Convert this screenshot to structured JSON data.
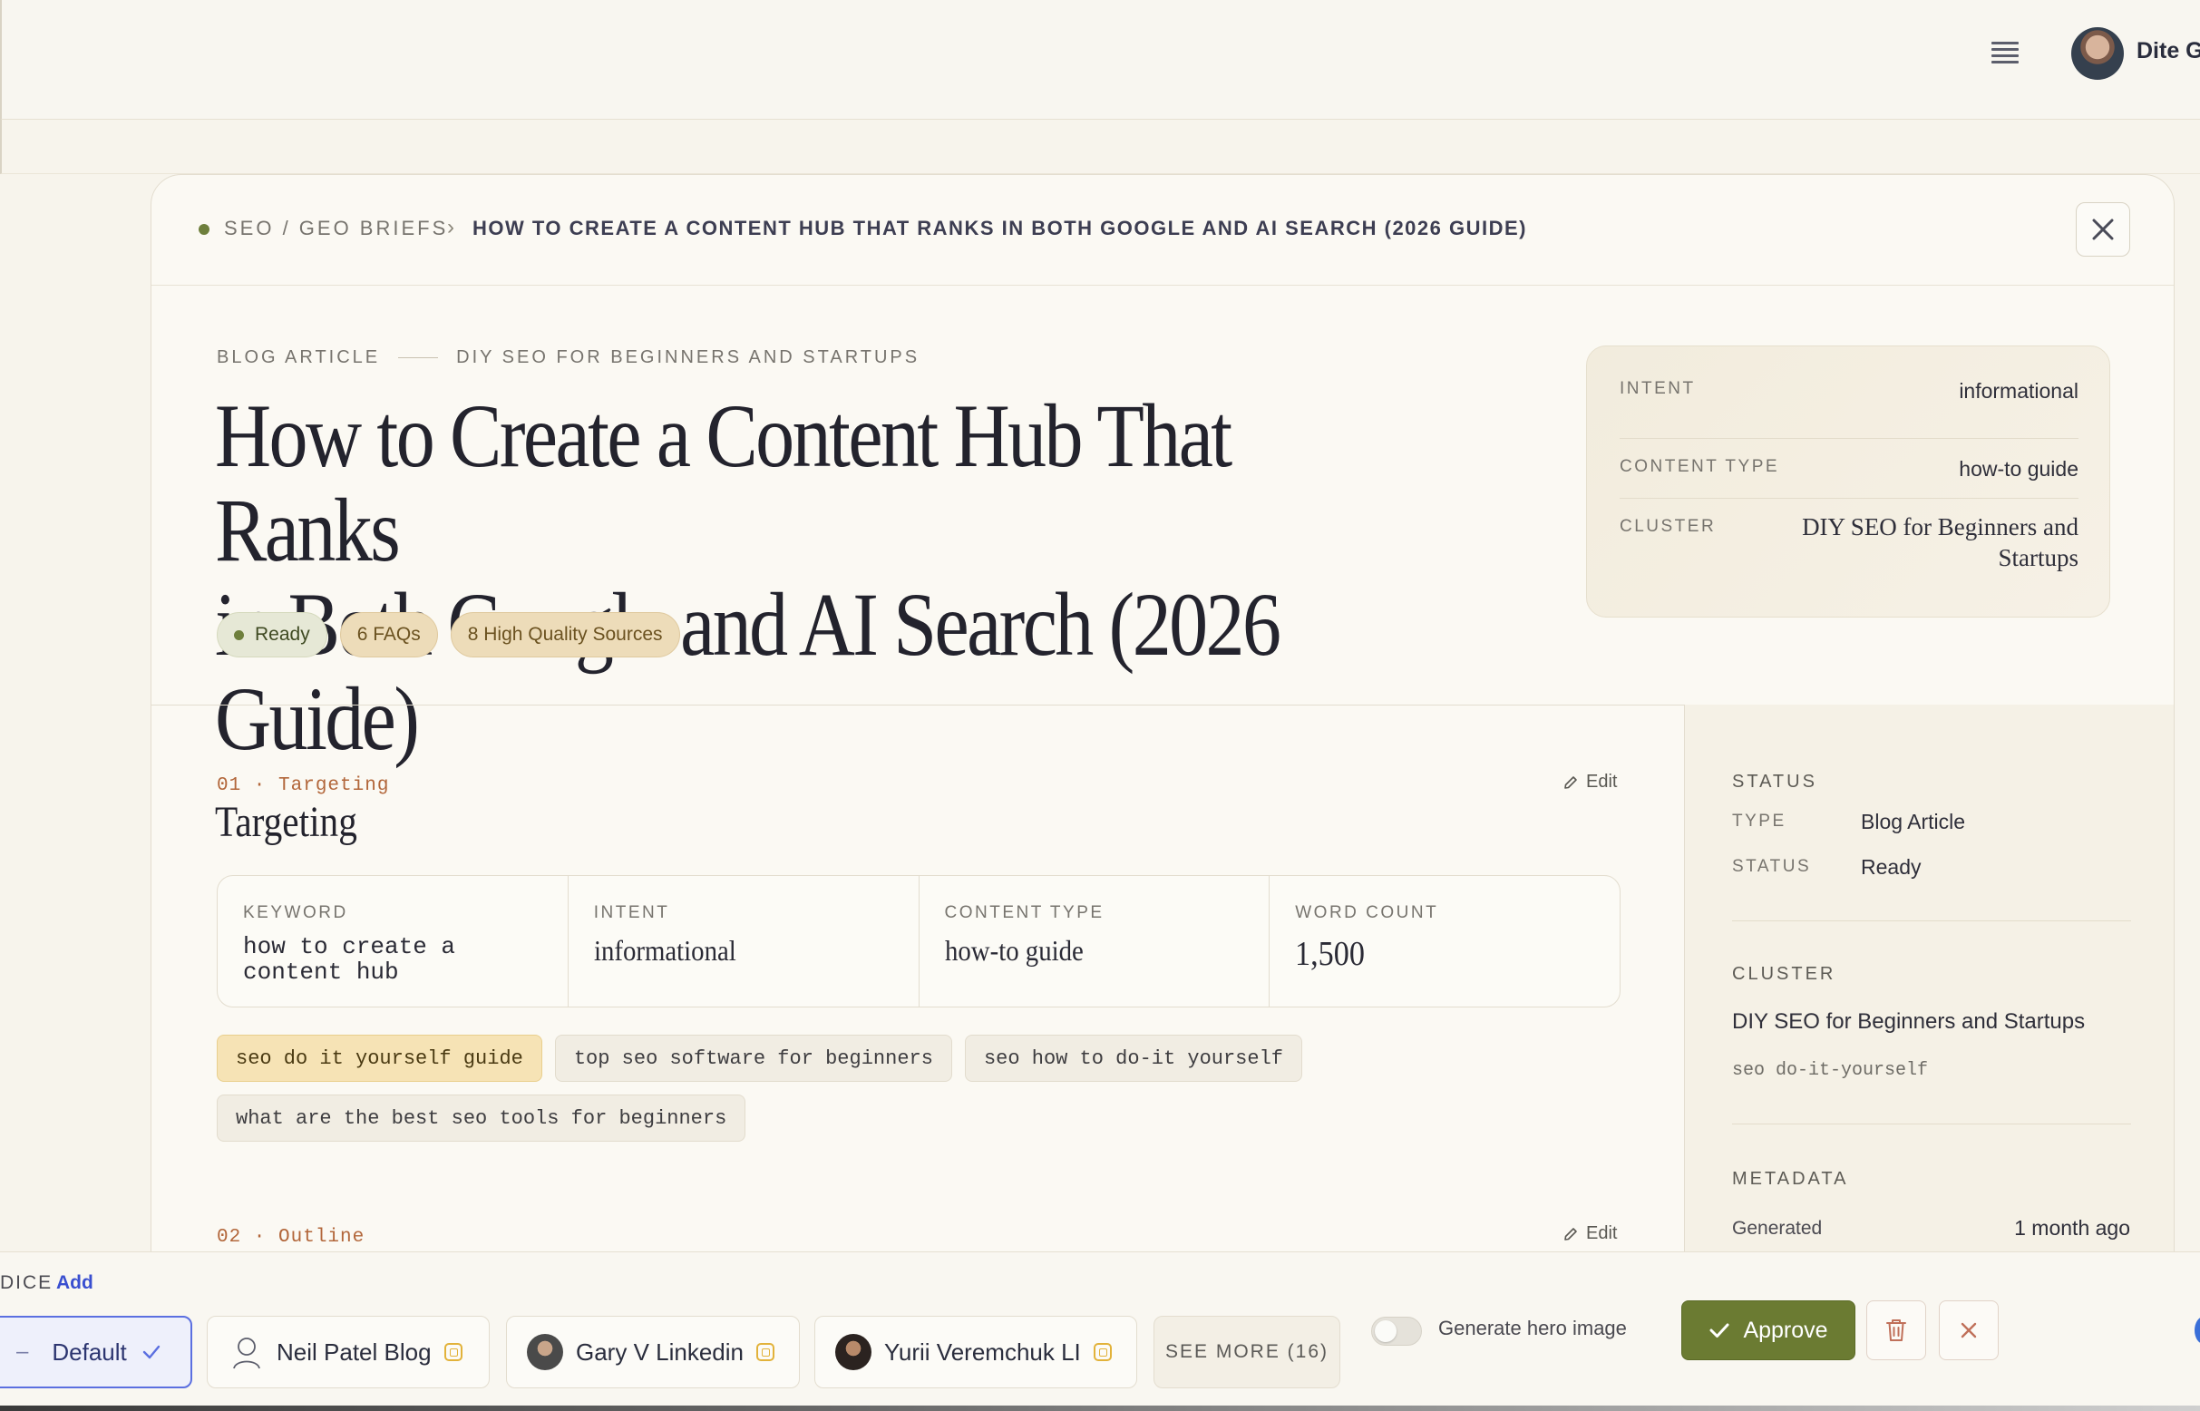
{
  "user": {
    "name": "Dite Ga"
  },
  "breadcrumb": {
    "root": "SEO / GEO BRIEFS",
    "separator": "›",
    "current": "HOW TO CREATE A CONTENT HUB THAT RANKS IN BOTH GOOGLE AND AI SEARCH (2026 GUIDE)"
  },
  "hero": {
    "type_label": "BLOG ARTICLE",
    "cluster_label": "DIY SEO FOR BEGINNERS AND STARTUPS",
    "title_line1": "How to Create a Content Hub That Ranks",
    "title_line2": "in Both Google and AI Search (2026 Guide)",
    "pills": {
      "ready": "Ready",
      "faqs": "6 FAQs",
      "sources": "8 High Quality Sources"
    }
  },
  "info_card": {
    "intent_key": "INTENT",
    "intent_value": "informational",
    "content_type_key": "CONTENT TYPE",
    "content_type_value": "how-to guide",
    "cluster_key": "CLUSTER",
    "cluster_value_line1": "DIY SEO for Beginners and",
    "cluster_value_line2": "Startups"
  },
  "targeting": {
    "number": "01 · Targeting",
    "title": "Targeting",
    "edit": "Edit",
    "metrics": {
      "keyword_key": "KEYWORD",
      "keyword_line1": "how to create a",
      "keyword_line2": "content hub",
      "intent_key": "INTENT",
      "intent_value": "informational",
      "content_type_key": "CONTENT TYPE",
      "content_type_value": "how-to guide",
      "word_count_key": "WORD COUNT",
      "word_count_value": "1,500"
    },
    "chips": [
      "seo do it yourself guide",
      "top seo software for beginners",
      "seo how to do-it yourself",
      "what are the best seo tools for beginners"
    ]
  },
  "outline": {
    "number": "02 · Outline",
    "edit": "Edit"
  },
  "sidebar": {
    "status_head": "STATUS",
    "type_key": "TYPE",
    "type_value": "Blog Article",
    "status_key": "STATUS",
    "status_value": "Ready",
    "cluster_head": "CLUSTER",
    "cluster_name": "DIY SEO for Beginners and Startups",
    "cluster_keyword": "seo do-it-yourself",
    "metadata_head": "METADATA",
    "generated_key": "Generated",
    "generated_value": "1 month ago"
  },
  "bottom": {
    "voice_label": "DICE",
    "voice_add": "Add",
    "voices": [
      "Default",
      "Neil Patel Blog",
      "Gary V Linkedin",
      "Yurii Veremchuk LI"
    ],
    "see_more": "SEE MORE (16)",
    "hero_toggle_label": "Generate hero image",
    "approve": "Approve"
  },
  "colors": {
    "accent_green": "#6b7b32",
    "accent_blue": "#5b6fe0",
    "section_number": "#b2663a"
  }
}
